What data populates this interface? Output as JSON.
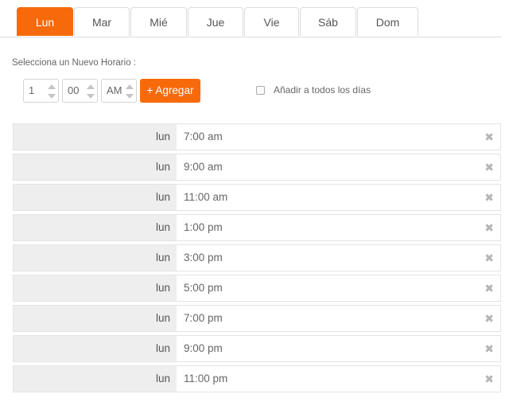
{
  "tabs": [
    {
      "label": "Lun",
      "active": true
    },
    {
      "label": "Mar",
      "active": false
    },
    {
      "label": "Mié",
      "active": false
    },
    {
      "label": "Jue",
      "active": false
    },
    {
      "label": "Vie",
      "active": false
    },
    {
      "label": "Sáb",
      "active": false
    },
    {
      "label": "Dom",
      "active": false
    }
  ],
  "scheduler": {
    "label": "Selecciona un Nuevo Horario :",
    "hour_value": "1",
    "minute_value": "00",
    "period_value": "AM",
    "add_button_label": "+ Agregar",
    "apply_all_label": "Añadir a todos los días",
    "apply_all_checked": false
  },
  "schedule": [
    {
      "day": "lun",
      "time": "7:00 am"
    },
    {
      "day": "lun",
      "time": "9:00 am"
    },
    {
      "day": "lun",
      "time": "11:00 am"
    },
    {
      "day": "lun",
      "time": "1:00 pm"
    },
    {
      "day": "lun",
      "time": "3:00 pm"
    },
    {
      "day": "lun",
      "time": "5:00 pm"
    },
    {
      "day": "lun",
      "time": "7:00 pm"
    },
    {
      "day": "lun",
      "time": "9:00 pm"
    },
    {
      "day": "lun",
      "time": "11:00 pm"
    }
  ],
  "icons": {
    "remove": "close-icon",
    "spinner": "spinner-arrows-icon"
  },
  "colors": {
    "accent": "#f76a0c",
    "day_cell_bg": "#eeeeee",
    "border": "#e4e4e4"
  },
  "glyphs": {
    "remove": "✖"
  }
}
